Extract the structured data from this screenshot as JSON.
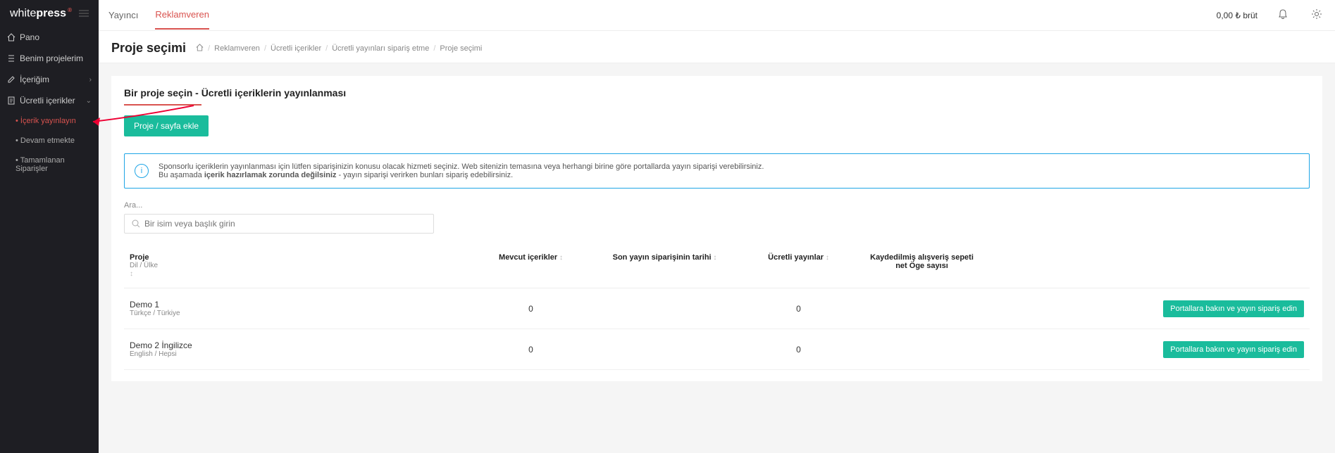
{
  "logo": {
    "part1": "white",
    "part2": "press",
    "reg": "®"
  },
  "sidebar": {
    "items": [
      {
        "label": "Pano"
      },
      {
        "label": "Benim projelerim"
      },
      {
        "label": "İçeriğim"
      },
      {
        "label": "Ücretli içerikler"
      }
    ],
    "sub": [
      {
        "label": "İçerik yayınlayın"
      },
      {
        "label": "Devam etmekte"
      },
      {
        "label": "Tamamlanan Siparişler"
      }
    ]
  },
  "topbar": {
    "tab1": "Yayıncı",
    "tab2": "Reklamveren",
    "balance": "0,00 ₺ brüt"
  },
  "page": {
    "title": "Proje seçimi",
    "crumbs": [
      "Reklamveren",
      "Ücretli içerikler",
      "Ücretli yayınları sipariş etme",
      "Proje seçimi"
    ]
  },
  "card": {
    "heading": "Bir proje seçin - Ücretli içeriklerin yayınlanması",
    "addBtn": "Proje / sayfa ekle",
    "alert": {
      "line1": "Sponsorlu içeriklerin yayınlanması için lütfen siparişinizin konusu olacak hizmeti seçiniz. Web sitenizin temasına veya herhangi birine göre portallarda yayın siparişi verebilirsiniz.",
      "line2a": "Bu aşamada ",
      "line2b": "içerik hazırlamak zorunda değilsiniz",
      "line2c": " - yayın siparişi verirken bunları sipariş edebilirsiniz."
    },
    "search": {
      "label": "Ara...",
      "placeholder": "Bir isim veya başlık girin"
    },
    "headers": {
      "proj": "Proje",
      "projSub": "Dil / Ülke",
      "mev": "Mevcut içerikler",
      "son": "Son yayın siparişinin tarihi",
      "ucr": "Ücretli yayınlar",
      "kay": "Kaydedilmiş alışveriş sepeti net Öge sayısı"
    },
    "rows": [
      {
        "name": "Demo 1",
        "lang": "Türkçe / Türkiye",
        "mev": "0",
        "son": "",
        "ucr": "0",
        "kay": "",
        "btn": "Portallara bakın ve yayın sipariş edin"
      },
      {
        "name": "Demo 2 İngilizce",
        "lang": "English / Hepsi",
        "mev": "0",
        "son": "",
        "ucr": "0",
        "kay": "",
        "btn": "Portallara bakın ve yayın sipariş edin"
      }
    ]
  }
}
